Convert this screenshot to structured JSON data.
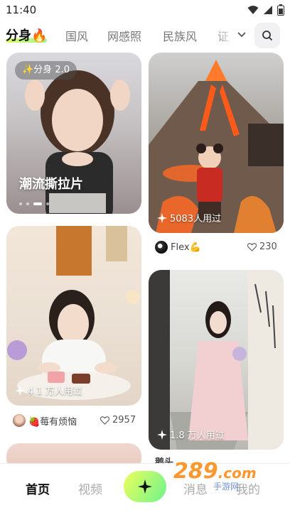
{
  "status": {
    "time": "11:40"
  },
  "tabs": {
    "items": [
      {
        "label": "分身🔥",
        "active": true
      },
      {
        "label": "国风"
      },
      {
        "label": "网感照"
      },
      {
        "label": "民族风"
      },
      {
        "label": "证"
      }
    ]
  },
  "cards": {
    "c1": {
      "badge": "✨分身 2.0",
      "title": "潮流撕拉片"
    },
    "c2": {
      "users": "5083人用过",
      "author": "Flex💪",
      "likes": "230"
    },
    "c3": {
      "users": "4.1 万人用过",
      "author": "🍓莓有烦恼",
      "likes": "2957"
    },
    "c4": {
      "users": "1.8 万人用过",
      "author_partial": "鹅头"
    }
  },
  "nav": {
    "home": "首页",
    "video": "视频",
    "messages": "消息",
    "mine": "我的"
  },
  "watermark": {
    "brand": "289",
    "suffix": ".com",
    "sub": "手游网"
  },
  "colors": {
    "accent_start": "#ecff5a",
    "accent_end": "#6ff28e"
  }
}
